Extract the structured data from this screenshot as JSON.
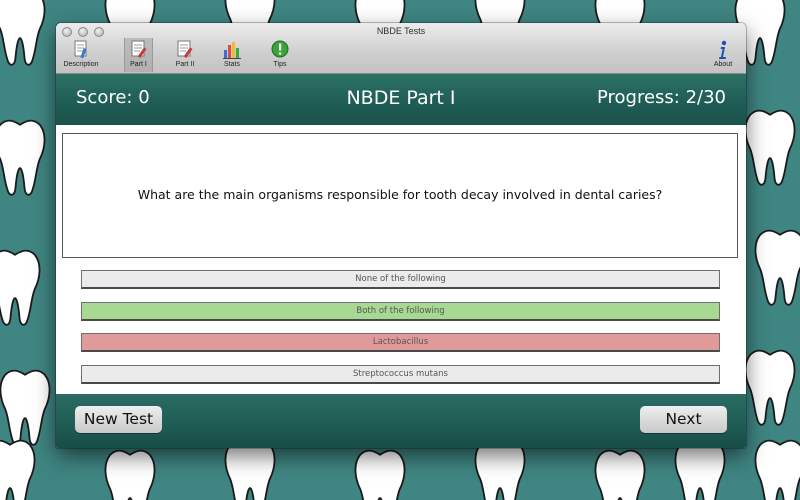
{
  "window": {
    "title": "NBDE Tests"
  },
  "toolbar": {
    "items": [
      {
        "label": "Description",
        "icon": "description-icon"
      },
      {
        "label": "Part I",
        "icon": "part-one-icon",
        "selected": true
      },
      {
        "label": "Part II",
        "icon": "part-two-icon"
      },
      {
        "label": "Stats",
        "icon": "stats-icon"
      },
      {
        "label": "Tips",
        "icon": "tips-icon"
      },
      {
        "label": "About",
        "icon": "about-icon"
      }
    ]
  },
  "header": {
    "score": "Score: 0",
    "title": "NBDE Part I",
    "progress": "Progress: 2/30"
  },
  "question": {
    "text": "What are the main organisms responsible for tooth decay involved in dental caries?"
  },
  "answers": [
    {
      "label": "None of the following",
      "state": "neutral",
      "color": "#ebebeb"
    },
    {
      "label": "Both of the following",
      "state": "correct",
      "color": "#a7d993"
    },
    {
      "label": "Lactobacillus",
      "state": "incorrect",
      "color": "#e19a9a"
    },
    {
      "label": "Streptococcus mutans",
      "state": "neutral",
      "color": "#ebebeb"
    }
  ],
  "footer": {
    "new_test_label": "New Test",
    "next_label": "Next"
  },
  "colors": {
    "background": "#3f8582",
    "header": "#1f5d55",
    "correct": "#a7d993",
    "incorrect": "#e19a9a"
  }
}
